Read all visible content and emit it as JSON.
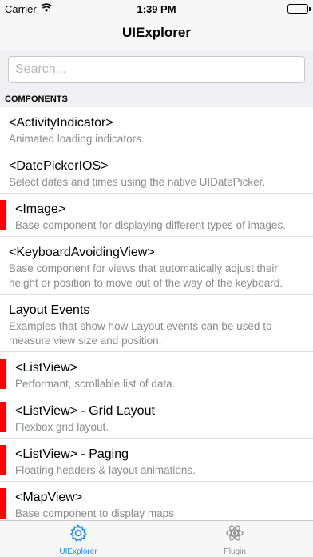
{
  "status_bar": {
    "carrier": "Carrier",
    "time": "1:39 PM"
  },
  "nav_bar": {
    "title": "UIExplorer"
  },
  "search": {
    "placeholder": "Search...",
    "value": ""
  },
  "section": {
    "title": "COMPONENTS"
  },
  "rows": [
    {
      "title": "<ActivityIndicator>",
      "description": "Animated loading indicators.",
      "flagged": false
    },
    {
      "title": "<DatePickerIOS>",
      "description": "Select dates and times using the native UIDatePicker.",
      "flagged": false
    },
    {
      "title": "<Image>",
      "description": "Base component for displaying different types of images.",
      "flagged": true
    },
    {
      "title": "<KeyboardAvoidingView>",
      "description": "Base component for views that automatically adjust their height or position to move out of the way of the keyboard.",
      "flagged": false
    },
    {
      "title": "Layout Events",
      "description": "Examples that show how Layout events can be used to measure view size and position.",
      "flagged": false
    },
    {
      "title": "<ListView>",
      "description": "Performant, scrollable list of data.",
      "flagged": true
    },
    {
      "title": "<ListView> - Grid Layout",
      "description": "Flexbox grid layout.",
      "flagged": true
    },
    {
      "title": "<ListView> - Paging",
      "description": "Floating headers & layout animations.",
      "flagged": true
    },
    {
      "title": "<MapView>",
      "description": "Base component to display maps",
      "flagged": true
    }
  ],
  "tabs": [
    {
      "label": "UIExplorer",
      "icon": "gear-icon",
      "active": true
    },
    {
      "label": "Plugin",
      "icon": "atom-icon",
      "active": false
    }
  ],
  "colors": {
    "accent": "#1a8cff",
    "flag": "#ff0000",
    "description": "#8c8c8c"
  }
}
